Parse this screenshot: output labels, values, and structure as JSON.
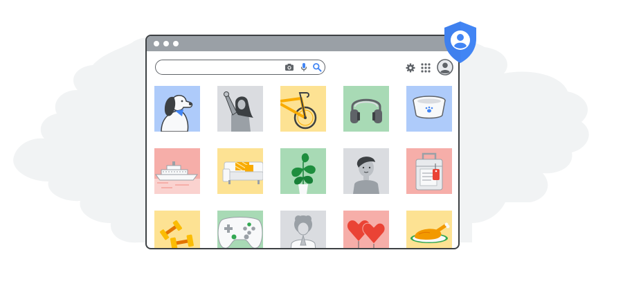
{
  "browser": {
    "window_dots": [
      "close",
      "minimize",
      "maximize"
    ],
    "search": {
      "value": "",
      "placeholder": ""
    },
    "search_icons": [
      "camera-icon",
      "microphone-icon",
      "search-icon"
    ],
    "toolbar_icons": [
      "gear-icon",
      "apps-grid-icon",
      "account-avatar-icon"
    ]
  },
  "badge": {
    "icon": "shield-account-icon",
    "color": "#4285f4"
  },
  "colors": {
    "blue": "#aecbfa",
    "gray": "#dadce0",
    "yellow": "#fde293",
    "green": "#a8dab5",
    "red": "#f6aea9",
    "frame": "#3c4043",
    "cloud": "#f1f3f4"
  },
  "tiles": [
    {
      "name": "dog",
      "bg": "#aecbfa"
    },
    {
      "name": "woman-waving",
      "bg": "#dadce0"
    },
    {
      "name": "bicycle",
      "bg": "#fde293"
    },
    {
      "name": "headphones",
      "bg": "#a8dab5"
    },
    {
      "name": "pet-bowl",
      "bg": "#aecbfa"
    },
    {
      "name": "cruise-ship",
      "bg": "#f6aea9"
    },
    {
      "name": "sofa",
      "bg": "#fde293"
    },
    {
      "name": "potted-plant",
      "bg": "#a8dab5"
    },
    {
      "name": "boy",
      "bg": "#dadce0"
    },
    {
      "name": "suitcase",
      "bg": "#f6aea9"
    },
    {
      "name": "dumbbells",
      "bg": "#fde293"
    },
    {
      "name": "game-controller",
      "bg": "#a8dab5"
    },
    {
      "name": "person-praying",
      "bg": "#dadce0"
    },
    {
      "name": "hearts",
      "bg": "#f6aea9"
    },
    {
      "name": "roast-turkey",
      "bg": "#fde293"
    }
  ]
}
